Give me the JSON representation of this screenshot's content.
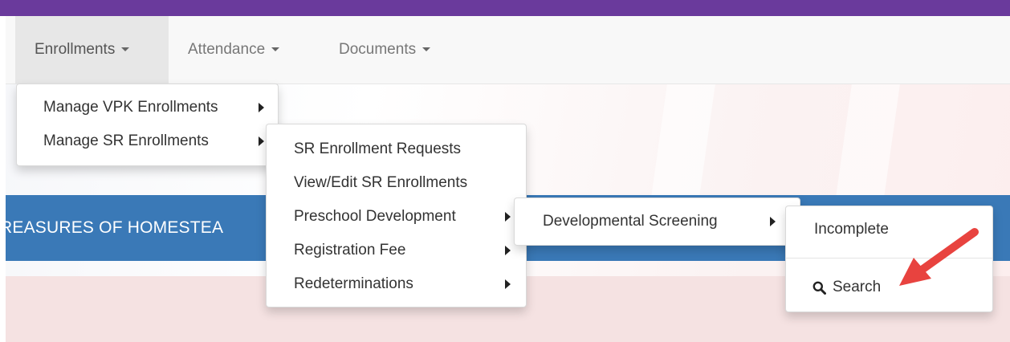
{
  "nav": {
    "enrollments": "Enrollments",
    "attendance": "Attendance",
    "documents": "Documents"
  },
  "menu1": {
    "vpk": "Manage VPK Enrollments",
    "sr": "Manage SR Enrollments"
  },
  "menu2": {
    "requests": "SR Enrollment Requests",
    "view_edit": "View/Edit SR Enrollments",
    "preschool": "Preschool Development",
    "registration": "Registration Fee",
    "redeterminations": "Redeterminations"
  },
  "menu3": {
    "screening": "Developmental Screening"
  },
  "menu4": {
    "incomplete": "Incomplete",
    "search": "Search"
  },
  "banner": {
    "text": "REASURES OF HOMESTEA"
  },
  "colors": {
    "top_bar": "#6a3a9c",
    "banner": "#3a79b7",
    "arrow": "#e8433f"
  }
}
